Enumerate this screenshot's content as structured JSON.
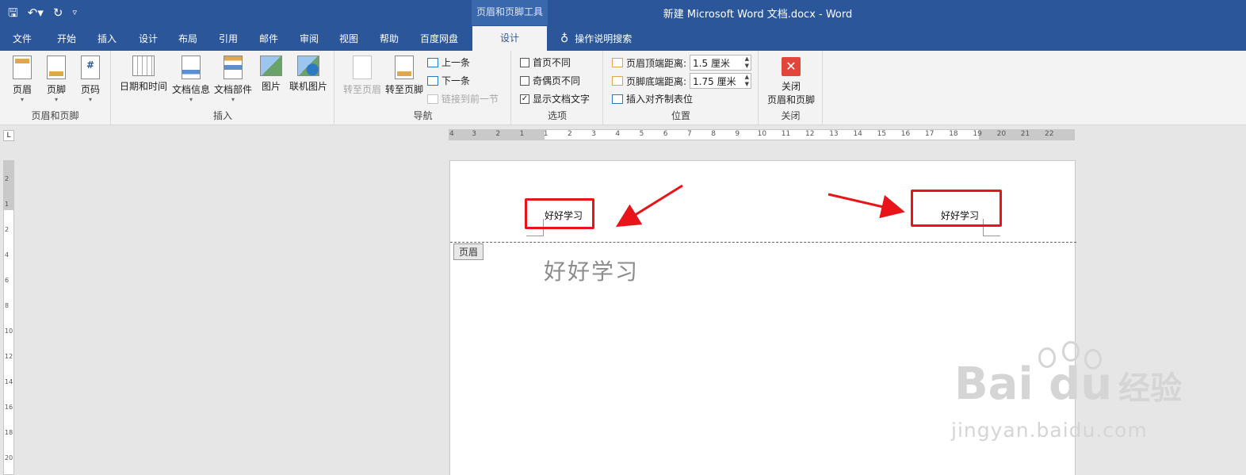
{
  "titlebar": {
    "context_tools": "页眉和页脚工具",
    "document_title": "新建 Microsoft Word 文档.docx  -  Word"
  },
  "tabs": [
    "文件",
    "开始",
    "插入",
    "设计",
    "布局",
    "引用",
    "邮件",
    "审阅",
    "视图",
    "帮助",
    "百度网盘"
  ],
  "active_tab": "设计",
  "tell_me": "操作说明搜索",
  "ribbon": {
    "hf_group": {
      "label": "页眉和页脚",
      "header": "页眉",
      "footer": "页脚",
      "page_number": "页码"
    },
    "insert_group": {
      "label": "插入",
      "datetime": "日期和时间",
      "docinfo": "文档信息",
      "parts": "文档部件",
      "picture": "图片",
      "online_picture": "联机图片"
    },
    "nav_group": {
      "label": "导航",
      "goto_header": "转至页眉",
      "goto_footer": "转至页脚",
      "previous": "上一条",
      "next": "下一条",
      "link_previous": "链接到前一节"
    },
    "options_group": {
      "label": "选项",
      "first_page": "首页不同",
      "odd_even": "奇偶页不同",
      "show_doc_text": "显示文档文字",
      "show_doc_text_checked": "✓"
    },
    "position_group": {
      "label": "位置",
      "header_top_label": "页眉顶端距离:",
      "header_top_value": "1.5 厘米",
      "footer_bottom_label": "页脚底端距离:",
      "footer_bottom_value": "1.75 厘米",
      "insert_align_tab": "插入对齐制表位"
    },
    "close_group": {
      "label": "关闭",
      "close_line1": "关闭",
      "close_line2": "页眉和页脚"
    }
  },
  "ruler": {
    "corner": "L",
    "labels": [
      "4",
      "3",
      "2",
      "1",
      "1",
      "2",
      "3",
      "4",
      "5",
      "6",
      "7",
      "8",
      "9",
      "10",
      "11",
      "12",
      "13",
      "14",
      "15",
      "16",
      "17",
      "18",
      "19",
      "20",
      "21",
      "22"
    ],
    "vertical_labels": [
      "2",
      "1",
      "2",
      "4",
      "6",
      "8",
      "10",
      "12",
      "14",
      "16",
      "18",
      "20"
    ]
  },
  "document": {
    "header_left_text": "好好学习",
    "header_right_text": "好好学习",
    "header_tag": "页眉",
    "body_text": "好好学习"
  },
  "watermark": {
    "brand": "Bai  du",
    "cn": "经验",
    "url": "jingyan.baidu.com"
  },
  "colors": {
    "word_blue": "#2b579a",
    "annotation_red": "#e8141a"
  }
}
